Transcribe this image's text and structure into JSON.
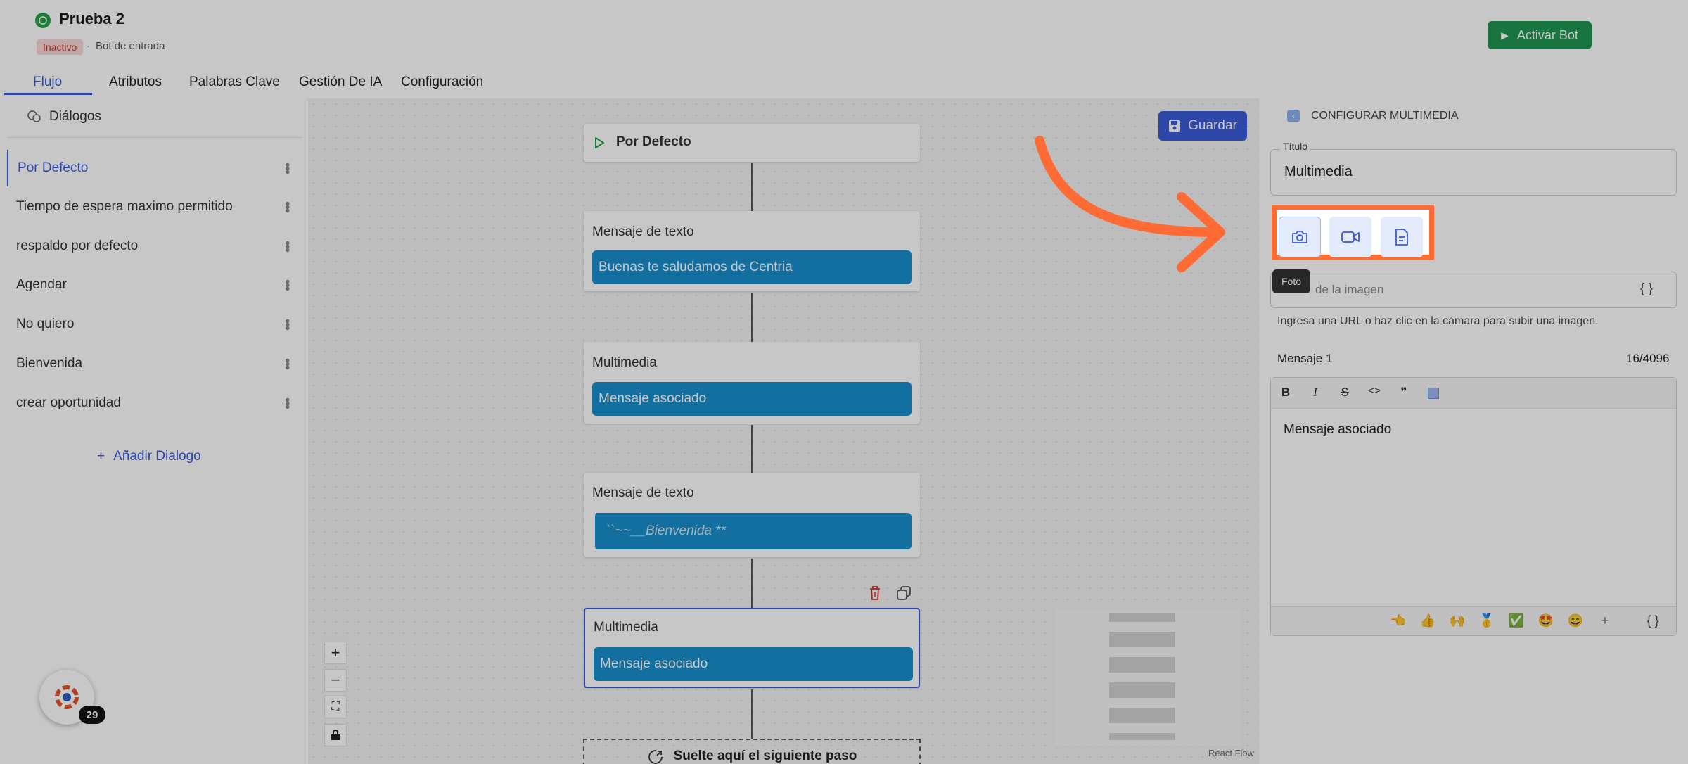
{
  "header": {
    "app_icon": "whatsapp-icon",
    "title": "Prueba 2",
    "status": "Inactivo",
    "bot_type": "Bot de entrada",
    "activate_label": "Activar Bot"
  },
  "tabs": [
    {
      "label": "Flujo",
      "active": true
    },
    {
      "label": "Atributos"
    },
    {
      "label": "Palabras Clave"
    },
    {
      "label": "Gestión De IA"
    },
    {
      "label": "Configuración"
    }
  ],
  "sidebar": {
    "heading": "Diálogos",
    "items": [
      {
        "label": "Por Defecto",
        "active": true
      },
      {
        "label": "Tiempo de espera maximo permitido"
      },
      {
        "label": "respaldo por defecto"
      },
      {
        "label": "Agendar"
      },
      {
        "label": "No quiero"
      },
      {
        "label": "Bienvenida"
      },
      {
        "label": "crear oportunidad"
      }
    ],
    "add_label": "Añadir Dialogo"
  },
  "canvas": {
    "save_label": "Guardar",
    "start_node": "Por Defecto",
    "nodes": [
      {
        "title": "Mensaje de texto",
        "message": "Buenas te saludamos de Centria"
      },
      {
        "title": "Multimedia",
        "message": "Mensaje asociado"
      },
      {
        "title": "Mensaje de texto",
        "message": "``~~__Bienvenida **"
      },
      {
        "title": "Multimedia",
        "message": "Mensaje asociado",
        "selected": true
      }
    ],
    "drop_label": "Suelte aquí el siguiente paso",
    "attribution": "React Flow"
  },
  "config_panel": {
    "heading": "CONFIGURAR MULTIMEDIA",
    "title_label": "Título",
    "title_value": "Multimedia",
    "media_buttons": [
      "camera-icon",
      "video-icon",
      "document-icon"
    ],
    "tooltip": "Foto",
    "url_placeholder": "de la imagen",
    "url_var": "{ }",
    "url_help": "Ingresa una URL o haz clic en la cámara para subir una imagen.",
    "message_label": "Mensaje 1",
    "message_count": "16/4096",
    "toolbar": [
      "B",
      "I",
      "S",
      "<>",
      "❞"
    ],
    "message_text": "Mensaje asociado",
    "emojis": [
      "👈",
      "👍",
      "🙌",
      "🥇",
      "✅",
      "🤩",
      "😄"
    ],
    "footer_plus": "+",
    "footer_var": "{ }"
  },
  "chat_widget": {
    "count": "29"
  },
  "colors": {
    "accent": "#3a5bd9",
    "success": "#219653",
    "message_bubble": "#1a8fcf",
    "highlight": "#ff6b35"
  }
}
